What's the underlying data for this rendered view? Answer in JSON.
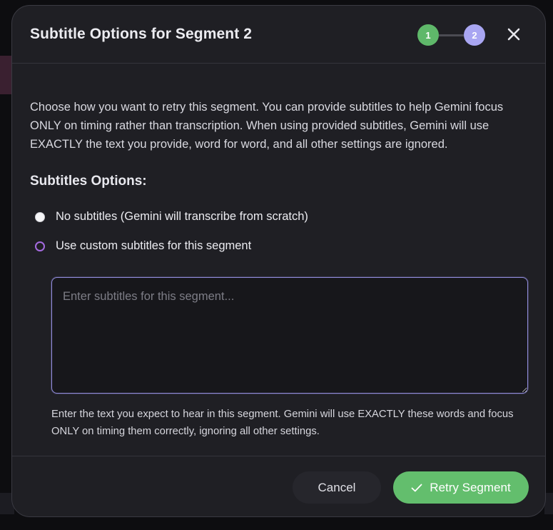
{
  "dialog": {
    "title": "Subtitle Options for Segment 2",
    "steps": [
      "1",
      "2"
    ],
    "close_icon": "close-icon",
    "intro": "Choose how you want to retry this segment. You can provide subtitles to help Gemini focus ONLY on timing rather than transcription. When using provided subtitles, Gemini will use EXACTLY the text you provide, word for word, and all other settings are ignored.",
    "section_heading": "Subtitles Options:",
    "options": [
      {
        "label": "No subtitles (Gemini will transcribe from scratch)",
        "selected": false
      },
      {
        "label": "Use custom subtitles for this segment",
        "selected": true
      }
    ],
    "textarea": {
      "value": "",
      "placeholder": "Enter subtitles for this segment..."
    },
    "helper": "Enter the text you expect to hear in this segment. Gemini will use EXACTLY these words and focus ONLY on timing them correctly, ignoring all other settings.",
    "buttons": {
      "cancel": "Cancel",
      "retry": "Retry Segment",
      "retry_icon": "check-icon"
    }
  },
  "colors": {
    "accent_green": "#63be6d",
    "step_inactive": "#a9a6f2",
    "radio_accent": "#a56be0",
    "textarea_border": "#8f8ad8"
  }
}
